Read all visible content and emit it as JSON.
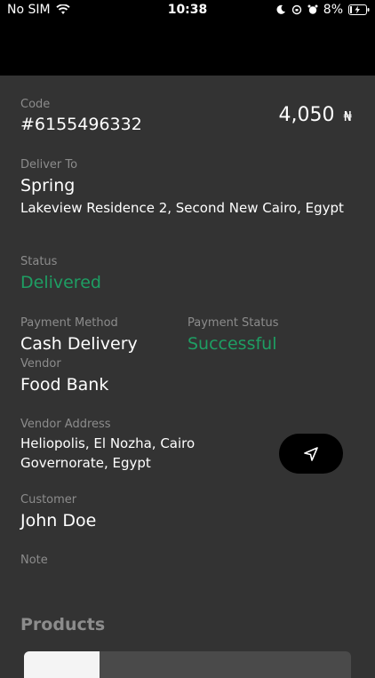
{
  "status_bar": {
    "carrier": "No SIM",
    "time": "10:38",
    "battery": "8%"
  },
  "order": {
    "code_label": "Code",
    "code": "#6155496332",
    "amount": "4,050",
    "currency": "₦",
    "deliver_to_label": "Deliver To",
    "deliver_to_name": "Spring",
    "deliver_to_address": "Lakeview Residence 2, Second New Cairo, Egypt",
    "status_label": "Status",
    "status": "Delivered",
    "payment_method_label": "Payment Method",
    "payment_method": "Cash Delivery",
    "payment_status_label": "Payment Status",
    "payment_status": "Successful",
    "vendor_label": "Vendor",
    "vendor": "Food Bank",
    "vendor_address_label": "Vendor Address",
    "vendor_address_line1": "Heliopolis, El Nozha, Cairo",
    "vendor_address_line2": "Governorate, Egypt",
    "customer_label": "Customer",
    "customer": "John Doe",
    "note_label": "Note",
    "note": ""
  },
  "products": {
    "title": "Products"
  },
  "colors": {
    "background": "#333333",
    "accent_green": "#1e9e63",
    "label_gray": "#8c8c8c"
  }
}
